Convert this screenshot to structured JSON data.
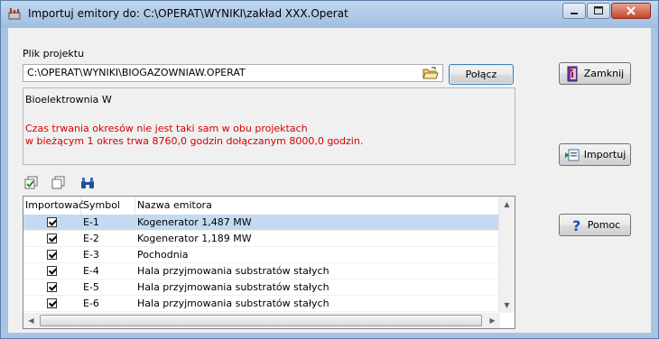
{
  "window": {
    "title": "Importuj emitory do: C:\\OPERAT\\WYNIKI\\zakład XXX.Operat"
  },
  "project": {
    "label": "Plik projektu",
    "path": "C:\\OPERAT\\WYNIKI\\BIOGAZOWNIAW.OPERAT",
    "connect_label": "Połącz"
  },
  "info": {
    "name": "Bioelektrownia W",
    "warning_line1": "Czas trwania okresów nie jest taki sam w obu projektach",
    "warning_line2": "w bieżącym 1 okres trwa 8760,0 godzin  dołączanym 8000,0 godzin."
  },
  "buttons": {
    "close": "Zamknij",
    "import": "Importuj",
    "help": "Pomoc"
  },
  "table": {
    "columns": [
      "Importować",
      "Symbol",
      "Nazwa emitora"
    ],
    "rows": [
      {
        "import": true,
        "symbol": "E-1",
        "name": "Kogenerator 1,487 MW",
        "selected": true
      },
      {
        "import": true,
        "symbol": "E-2",
        "name": "Kogenerator 1,189 MW"
      },
      {
        "import": true,
        "symbol": "E-3",
        "name": "Pochodnia"
      },
      {
        "import": true,
        "symbol": "E-4",
        "name": "Hala przyjmowania substratów stałych"
      },
      {
        "import": true,
        "symbol": "E-5",
        "name": "Hala przyjmowania substratów stałych"
      },
      {
        "import": true,
        "symbol": "E-6",
        "name": "Hala przyjmowania substratów stałych"
      }
    ]
  },
  "colors": {
    "warning": "#d40000",
    "selection": "#c3daf2"
  }
}
